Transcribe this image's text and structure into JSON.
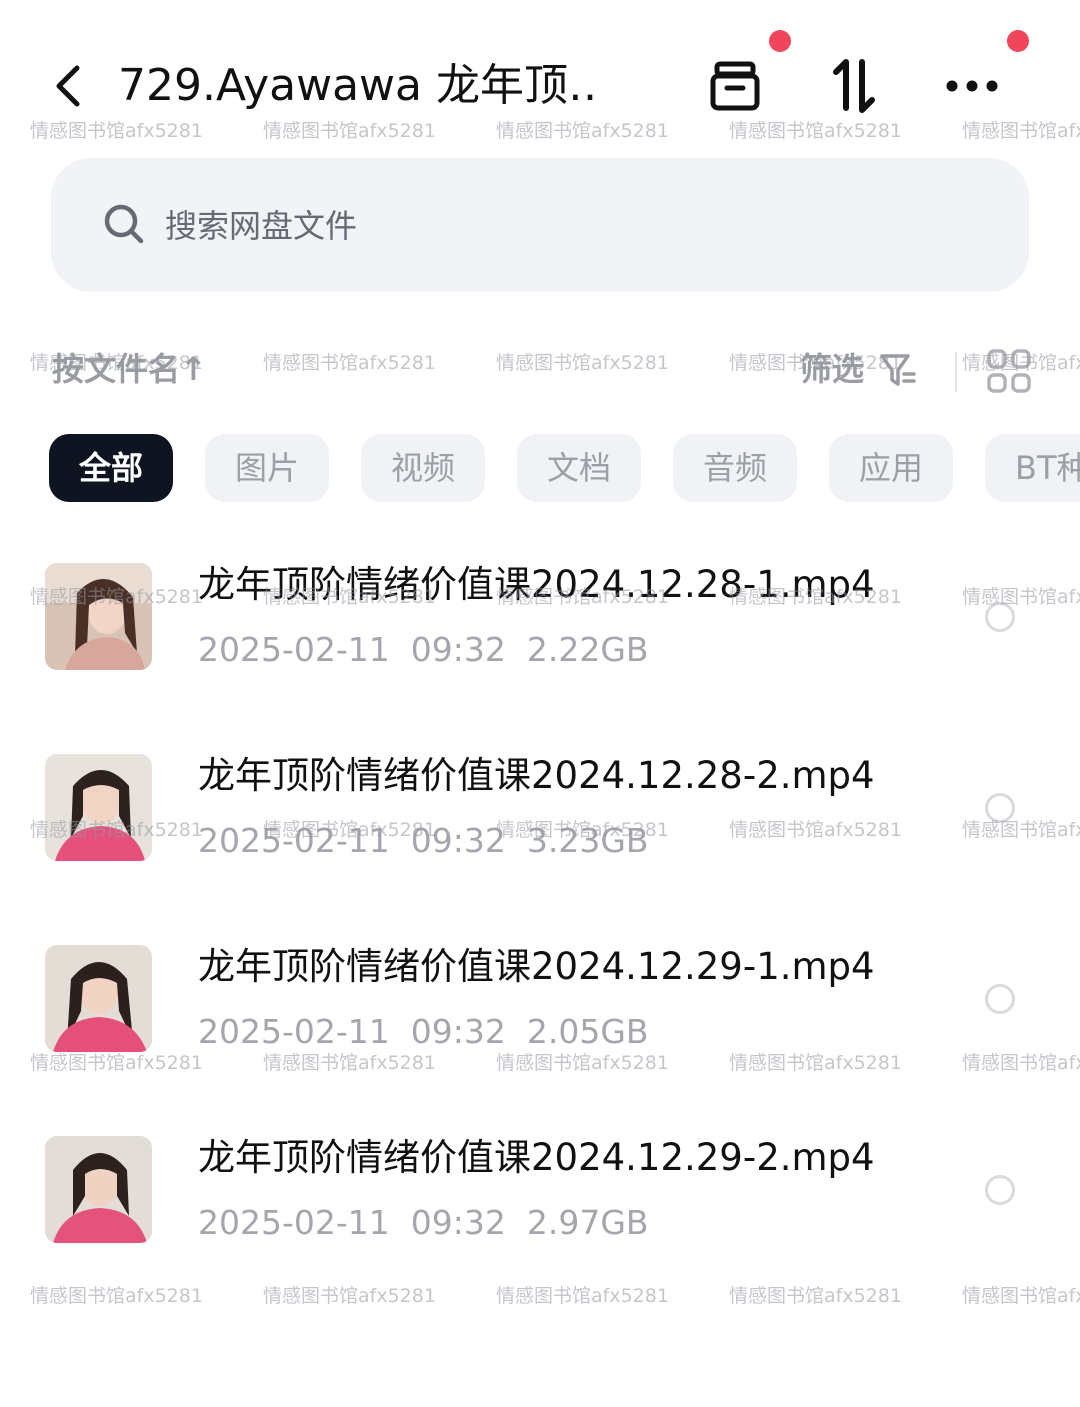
{
  "header": {
    "back_icon": "chevron-left-icon",
    "title": "729.Ayawawa 龙年顶…",
    "actions": [
      {
        "name": "archive-icon",
        "has_badge": true
      },
      {
        "name": "transfer-icon",
        "has_badge": false
      },
      {
        "name": "more-icon",
        "has_badge": true
      }
    ],
    "badge_color": "#f0465b"
  },
  "search": {
    "placeholder": "搜索网盘文件",
    "value": ""
  },
  "sort_bar": {
    "sort_label": "按文件名↑",
    "filter_label": "筛选",
    "view_toggle_icon": "grid-icon"
  },
  "chips": [
    {
      "label": "全部",
      "active": true
    },
    {
      "label": "图片",
      "active": false
    },
    {
      "label": "视频",
      "active": false
    },
    {
      "label": "文档",
      "active": false
    },
    {
      "label": "音频",
      "active": false
    },
    {
      "label": "应用",
      "active": false
    },
    {
      "label": "BT种",
      "active": false
    }
  ],
  "files": [
    {
      "name": "龙年顶阶情绪价值课2024.12.28-1.mp4",
      "date": "2025-02-11",
      "time": "09:32",
      "size": "2.22GB",
      "meta": "2025-02-11  09:32  2.22GB"
    },
    {
      "name": "龙年顶阶情绪价值课2024.12.28-2.mp4",
      "date": "2025-02-11",
      "time": "09:32",
      "size": "3.23GB",
      "meta": "2025-02-11  09:32  3.23GB"
    },
    {
      "name": "龙年顶阶情绪价值课2024.12.29-1.mp4",
      "date": "2025-02-11",
      "time": "09:32",
      "size": "2.05GB",
      "meta": "2025-02-11  09:32  2.05GB"
    },
    {
      "name": "龙年顶阶情绪价值课2024.12.29-2.mp4",
      "date": "2025-02-11",
      "time": "09:32",
      "size": "2.97GB",
      "meta": "2025-02-11  09:32  2.97GB"
    }
  ],
  "watermark": {
    "text": "情感图书馆afx5281"
  },
  "colors": {
    "active_chip": "#0e1521",
    "chip_bg": "#f1f2f6",
    "search_bg": "#f2f3f7",
    "meta_text": "#a4a6ad"
  }
}
